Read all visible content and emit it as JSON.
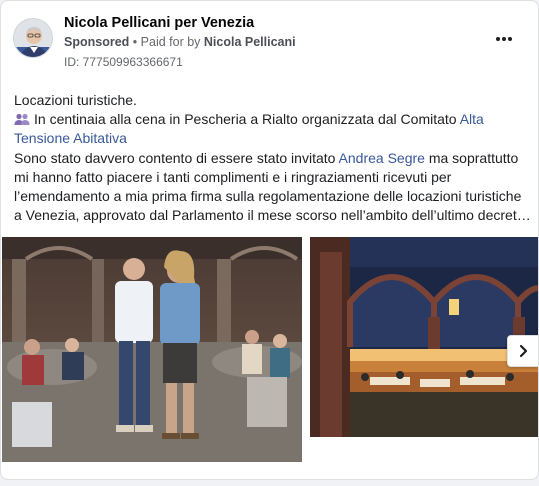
{
  "post": {
    "page_name": "Nicola Pellicani per Venezia",
    "sponsored": "Sponsored",
    "paid_for_prefix": "Paid for by",
    "paid_for_by": "Nicola Pellicani",
    "separator": "•",
    "ad_id": "ID: 777509963366671",
    "text": {
      "line1": "Locazioni turistiche.",
      "line2_prefix": "In centinaia alla cena in Pescheria a Rialto organizzata dal Comitato ",
      "line2_link": "Alta",
      "line3_link": "Tensione Abitativa",
      "line4_prefix": "Sono stato davvero contento di essere stato invitato ",
      "line4_link": "Andrea Segre",
      "line4_suffix": " ma soprattutto",
      "line5": "mi hanno fatto piacere i tanti complimenti e i ringraziamenti ricevuti per",
      "line6": "l’emendamento a mia prima firma sulla regolamentazione delle locazioni turistiche",
      "line7": "a Venezia, approvato dal Parlamento il mese scorso nell’ambito dell’ultimo decret…"
    }
  },
  "icons": {
    "more": "more-horizontal-icon",
    "people": "people-icon",
    "next": "chevron-right-icon"
  },
  "colors": {
    "link": "#385898",
    "meta": "#65676b",
    "background": "#f0f2f5"
  }
}
